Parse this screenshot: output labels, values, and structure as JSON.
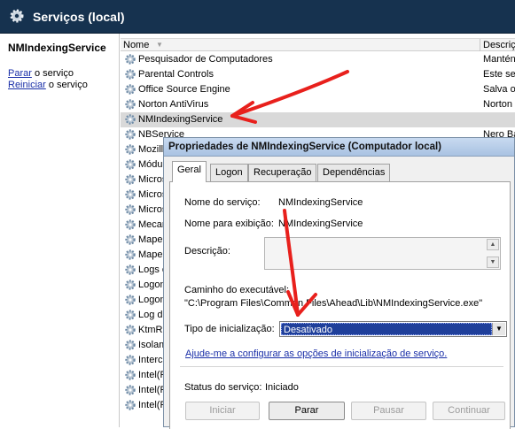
{
  "header": {
    "title": "Serviços (local)"
  },
  "left": {
    "service_name": "NMIndexingService",
    "stop_link": "Parar",
    "stop_rest": " o serviço",
    "restart_link": "Reiniciar",
    "restart_rest": " o serviço"
  },
  "list": {
    "col_name": "Nome",
    "col_desc": "Descriç",
    "rows": [
      {
        "name": "Pesquisador de Computadores",
        "desc": "Mantén"
      },
      {
        "name": "Parental Controls",
        "desc": "Este se"
      },
      {
        "name": "Office Source Engine",
        "desc": "Salva o"
      },
      {
        "name": "Norton AntiVirus",
        "desc": "Norton"
      },
      {
        "name": "NMIndexingService",
        "desc": ""
      },
      {
        "name": "NBService",
        "desc": "Nero Ba"
      },
      {
        "name": "Mozilla",
        "desc": ""
      },
      {
        "name": "Módul",
        "desc": ""
      },
      {
        "name": "Micros",
        "desc": ""
      },
      {
        "name": "Micros",
        "desc": ""
      },
      {
        "name": "Micros",
        "desc": ""
      },
      {
        "name": "Mecan",
        "desc": ""
      },
      {
        "name": "Mapea",
        "desc": ""
      },
      {
        "name": "Mapea",
        "desc": ""
      },
      {
        "name": "Logs e",
        "desc": ""
      },
      {
        "name": "Logon",
        "desc": ""
      },
      {
        "name": "Logon",
        "desc": ""
      },
      {
        "name": "Log de",
        "desc": ""
      },
      {
        "name": "KtmRr",
        "desc": ""
      },
      {
        "name": "Isolam",
        "desc": ""
      },
      {
        "name": "Interc",
        "desc": ""
      },
      {
        "name": "Intel(F",
        "desc": ""
      },
      {
        "name": "Intel(F",
        "desc": ""
      },
      {
        "name": "Intel(F",
        "desc": ""
      }
    ],
    "selected_index": 4
  },
  "dialog": {
    "title": "Propriedades de NMIndexingService (Computador local)",
    "tabs": [
      "Geral",
      "Logon",
      "Recuperação",
      "Dependências"
    ],
    "active_tab": 0,
    "service_name_label": "Nome do serviço:",
    "service_name_value": "NMIndexingService",
    "display_name_label": "Nome para exibição:",
    "display_name_value": "NMIndexingService",
    "description_label": "Descrição:",
    "path_label": "Caminho do executável:",
    "path_value": "\"C:\\Program Files\\Common Files\\Ahead\\Lib\\NMIndexingService.exe\"",
    "startup_label": "Tipo de inicialização:",
    "startup_value": "Desativado",
    "help_link": "Ajude-me a configurar as opções de inicialização de serviço.",
    "status_label": "Status do serviço:",
    "status_value": "Iniciado",
    "buttons": {
      "start": "Iniciar",
      "stop": "Parar",
      "pause": "Pausar",
      "continue": "Continuar"
    }
  },
  "colors": {
    "header_bg": "#16324f",
    "selected_combo": "#1f3f9a",
    "annotation_arrow": "#e8201c"
  }
}
